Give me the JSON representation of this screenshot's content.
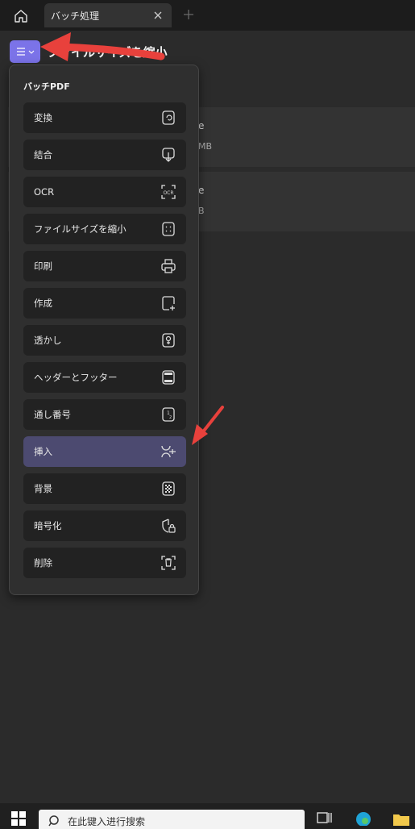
{
  "tabbar": {
    "home_icon": "home-icon",
    "tab_label": "バッチ処理",
    "close_icon": "close-icon",
    "add_icon": "plus-icon"
  },
  "header": {
    "menu_icon": "hamburger-icon",
    "title": "ファイルサイズを縮小"
  },
  "files": [
    {
      "name": "e",
      "size": "MB"
    },
    {
      "name": "e",
      "size": "B"
    }
  ],
  "dropdown": {
    "heading": "バッチPDF",
    "items": [
      {
        "label": "変換",
        "icon": "convert-icon"
      },
      {
        "label": "結合",
        "icon": "combine-icon"
      },
      {
        "label": "OCR",
        "icon": "ocr-icon"
      },
      {
        "label": "ファイルサイズを縮小",
        "icon": "compress-icon"
      },
      {
        "label": "印刷",
        "icon": "print-icon"
      },
      {
        "label": "作成",
        "icon": "create-icon"
      },
      {
        "label": "透かし",
        "icon": "watermark-icon"
      },
      {
        "label": "ヘッダーとフッター",
        "icon": "header-footer-icon"
      },
      {
        "label": "通し番号",
        "icon": "numbering-icon"
      },
      {
        "label": "挿入",
        "icon": "insert-icon",
        "selected": true
      },
      {
        "label": "背景",
        "icon": "background-icon"
      },
      {
        "label": "暗号化",
        "icon": "encrypt-icon"
      },
      {
        "label": "削除",
        "icon": "delete-icon"
      }
    ]
  },
  "taskbar": {
    "search_placeholder": "在此键入进行搜索"
  },
  "colors": {
    "accent": "#7b73e8",
    "selected_item": "#4c4a70",
    "annotation_arrow": "#e8413c"
  }
}
